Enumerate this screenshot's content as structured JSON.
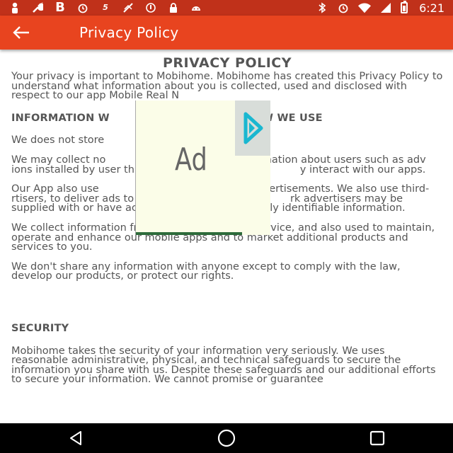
{
  "status_bar": {
    "time": "6:21",
    "left_icons": [
      "person-icon",
      "wrench-icon",
      "b-icon",
      "alarm-icon",
      "s5-icon",
      "no-connection-icon",
      "info-icon",
      "lock-icon",
      "android-icon"
    ],
    "right_icons": [
      "bluetooth-icon",
      "alarm-icon",
      "wifi-icon",
      "signal-icon",
      "battery-icon"
    ]
  },
  "app_bar": {
    "title": "Privacy Policy",
    "back_icon": "arrow-left-icon"
  },
  "document": {
    "title": "PRIVACY POLICY",
    "intro": "Your privacy is important to Mobihome. Mobihome has created this Privacy Policy to understand what information about you is collected, used and disclosed with respect to our app Mobile Real N",
    "section1_heading": "INFORMATION W                                         W WE USE",
    "p1": "We does not store                              mation.",
    "p2": "We may collect no                              cation information about users such as adv                    ions installed by user through our applic                         y interact with our apps.",
    "p3": "Our App also use                                      K for advertisements. We also use third-                       rtisers, to deliver ads to you on our                              rk advertisers may be supplied with or have access to your non personally identifiable information.",
    "p4": "We  collect information from you to provide our service, and also used to maintain, operate and enhance our mobile apps and to market additional products and services to you.",
    "p5": "We don't share any information with anyone except to comply with the law, develop our products, or protect our rights.",
    "section2_heading": "SECURITY",
    "p6": "Mobihome takes the security of your information very seriously. We uses reasonable administrative, physical, and technical safeguards to secure the information you share with us. Despite these safeguards and our additional efforts to secure your information. We  cannot promise or guarantee"
  },
  "ad": {
    "label": "Ad",
    "play_icon": "play-icon"
  },
  "nav_bar": {
    "icons": [
      "back-triangle-icon",
      "home-circle-icon",
      "recents-square-icon"
    ]
  },
  "colors": {
    "status_bar": "#c0311a",
    "app_bar": "#e8441f",
    "text": "#555555",
    "ad_background": "#fbfde8",
    "ad_play": "#1ab7d0"
  }
}
